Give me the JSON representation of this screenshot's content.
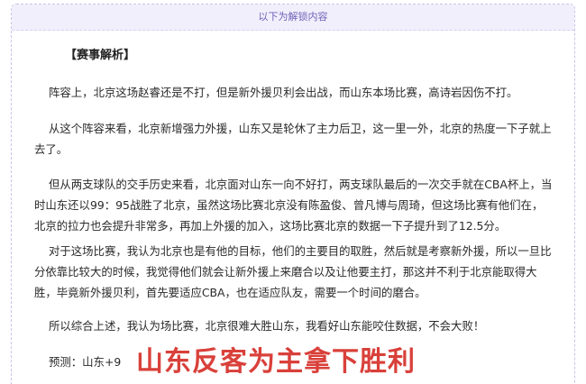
{
  "banner": {
    "text": "以下为解锁内容"
  },
  "analysis": {
    "heading": "【赛事解析】",
    "paragraphs": [
      "阵容上，北京这场赵睿还是不打，但是新外援贝利会出战，而山东本场比赛，高诗岩因伤不打。",
      "从这个阵容来看，北京新增强力外援，山东又是轮休了主力后卫，这一里一外，北京的热度一下子就上去了。",
      "但从两支球队的交手历史来看，北京面对山东一向不好打，两支球队最后的一次交手就在CBA杯上，当时山东还以99：95战胜了北京，虽然这场比赛北京没有陈盈俊、曾凡博与周琦，但这场比赛有他们在，北京的拉力也会提升非常多，再加上外援的加入，这场比赛北京的数据一下子提升到了12.5分。",
      "对于这场比赛，我认为北京也是有他的目标，他们的主要目的取胜，然后就是考察新外援，所以一旦比分依靠比较大的时候，我觉得他们就会让新外援上来磨合以及让他要主打，那这并不利于北京能取得大胜，毕竟新外援贝利，首先要适应CBA，也在适应队友，需要一个时间的磨合。",
      "所以综合上述，我认为场比赛，北京很难大胜山东，我看好山东能咬住数据，不会大败！"
    ],
    "prediction": "预测：山东+9",
    "highlight": "山东反客为主拿下胜利"
  },
  "colors": {
    "highlight": "#d9403a",
    "banner_bg": "#f2effc",
    "banner_text": "#6f63b8"
  }
}
